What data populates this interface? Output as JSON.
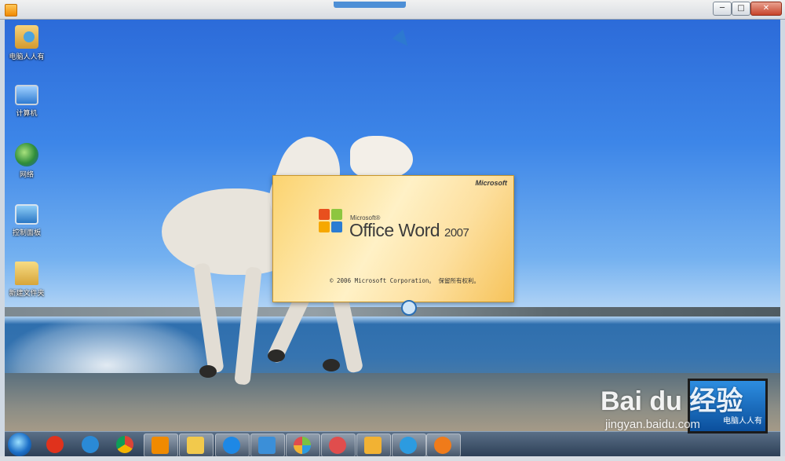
{
  "window": {
    "minimize": "─",
    "maximize": "□",
    "close": "✕"
  },
  "desktop_icons": [
    {
      "label": "电脑人人有",
      "icon": "user-folder-icon"
    },
    {
      "label": "计算机",
      "icon": "computer-icon"
    },
    {
      "label": "网络",
      "icon": "network-globe-icon"
    },
    {
      "label": "控制面板",
      "icon": "control-panel-icon"
    },
    {
      "label": "新建文件夹",
      "icon": "folder-icon"
    }
  ],
  "splash": {
    "brand": "Microsoft",
    "product_prefix": "Microsoft®",
    "product_name": "Office Word",
    "product_year": "2007",
    "copyright": "© 2006 Microsoft Corporation。 保留所有权利。"
  },
  "taskbar": {
    "items": [
      {
        "icon": "start-orb-icon"
      },
      {
        "icon": "jiang-app-icon",
        "color": "#e0321c"
      },
      {
        "icon": "internet-explorer-icon",
        "color": "#2a8ad6"
      },
      {
        "icon": "chrome-icon",
        "color": "#3aa757"
      },
      {
        "icon": "media-player-icon",
        "color": "#f08a00",
        "active": true
      },
      {
        "icon": "windows-explorer-icon",
        "color": "#f2c94c",
        "active": true
      },
      {
        "icon": "qq-browser-icon",
        "color": "#1e88e5",
        "active": true
      },
      {
        "icon": "remote-desktop-icon",
        "color": "#3b8fd8",
        "active": true
      },
      {
        "icon": "pinwheel-app-icon",
        "color": "#7ac143",
        "active": true
      },
      {
        "icon": "paint-icon",
        "color": "#e04d4d",
        "active": true
      },
      {
        "icon": "file-manager-icon",
        "color": "#f2b233",
        "active": true
      },
      {
        "icon": "video-app-icon",
        "color": "#2c9be0",
        "active": true
      },
      {
        "icon": "firefox-icon",
        "color": "#f07b1a",
        "active": true
      }
    ]
  },
  "watermark": {
    "logo": "Bai du 经验",
    "url": "jingyan.baidu.com",
    "thumb_text": "电脑人人有"
  }
}
